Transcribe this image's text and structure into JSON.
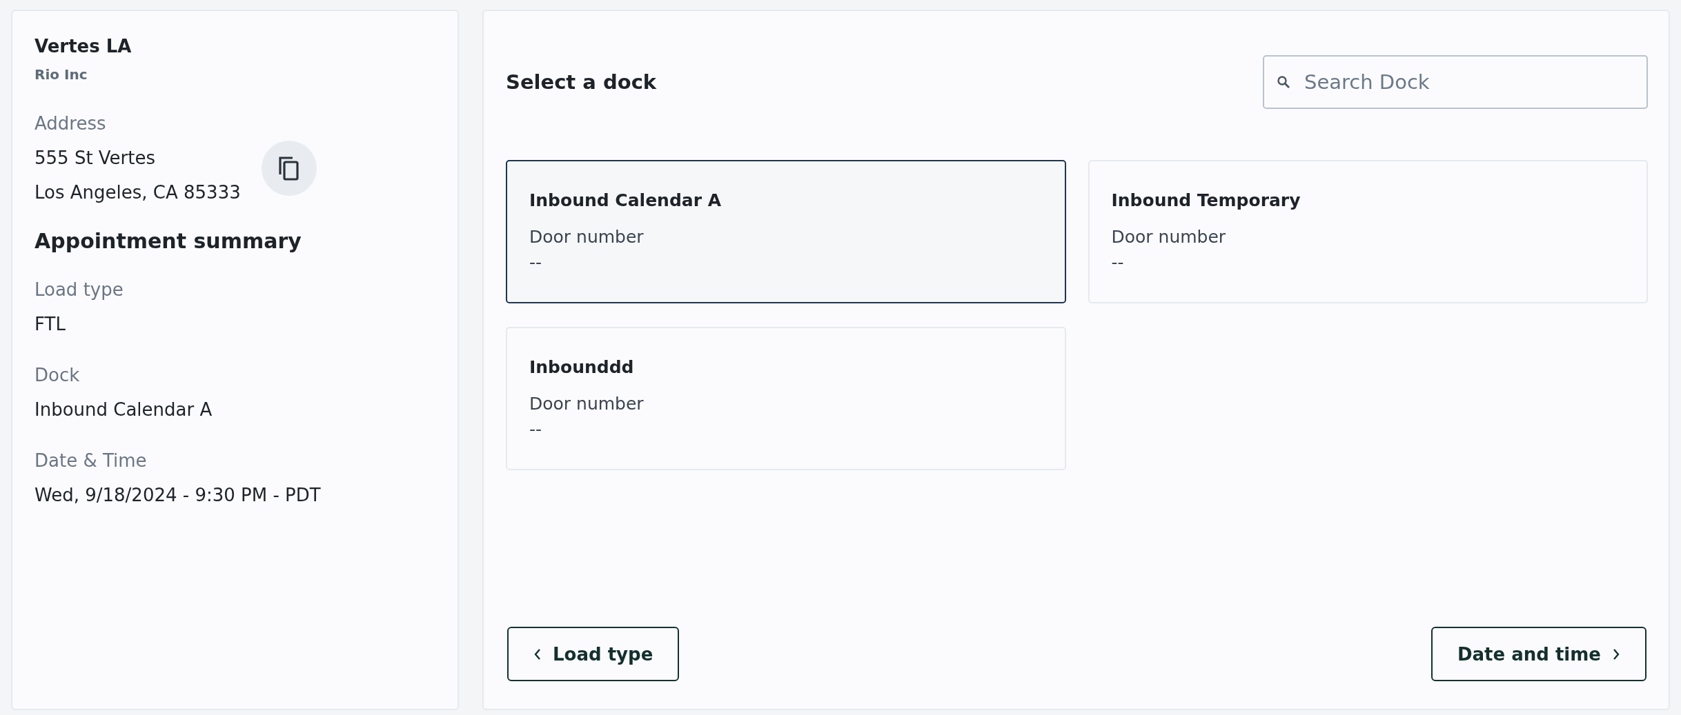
{
  "location": {
    "name": "Vertes LA",
    "company": "Rio Inc",
    "address_label": "Address",
    "address_lines": [
      "555 St Vertes",
      "Los Angeles, CA 85333"
    ]
  },
  "summary": {
    "title": "Appointment summary",
    "fields": [
      {
        "label": "Load type",
        "value": "FTL"
      },
      {
        "label": "Dock",
        "value": "Inbound Calendar A"
      },
      {
        "label": "Date & Time",
        "value": "Wed, 9/18/2024 - 9:30 PM - PDT"
      }
    ]
  },
  "dock_picker": {
    "title": "Select a dock",
    "search": {
      "placeholder": "Search Dock"
    },
    "docks": [
      {
        "name": "Inbound Calendar A",
        "door_label": "Door number",
        "door": "--",
        "selected": true
      },
      {
        "name": "Inbound Temporary",
        "door_label": "Door number",
        "door": "--",
        "selected": false
      },
      {
        "name": "Inbounddd",
        "door_label": "Door number",
        "door": "--",
        "selected": false
      }
    ]
  },
  "buttons": {
    "back": "Load type",
    "next": "Date and time"
  }
}
